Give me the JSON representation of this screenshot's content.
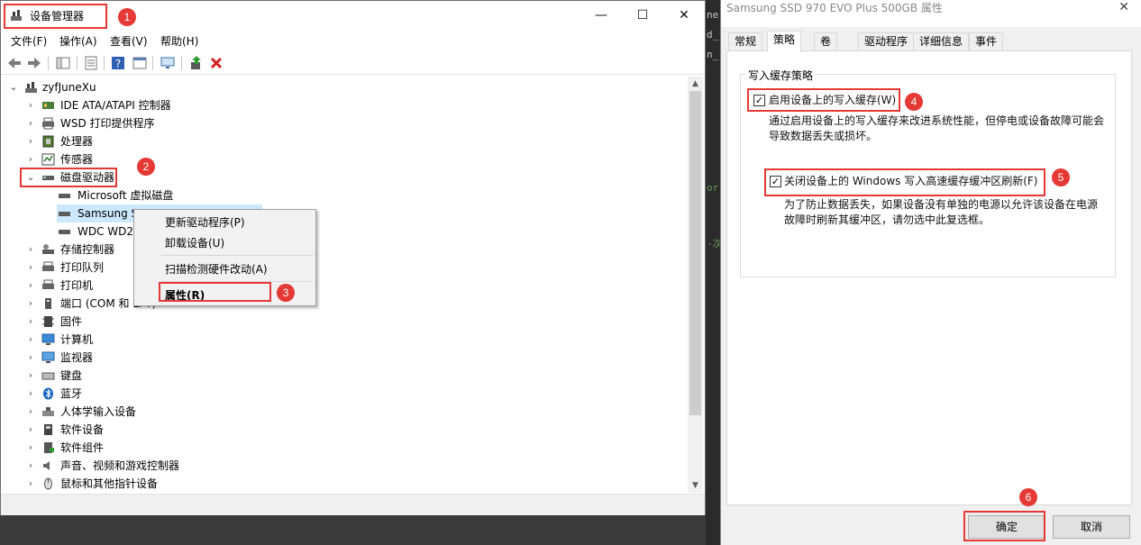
{
  "device_manager": {
    "title": "设备管理器",
    "menus": [
      "文件(F)",
      "操作(A)",
      "查看(V)",
      "帮助(H)"
    ],
    "window_controls": {
      "minimize": "—",
      "maximize": "☐",
      "close": "✕"
    },
    "tree": {
      "root": "zyfJuneXu",
      "categories": [
        {
          "label": "IDE ATA/ATAPI 控制器",
          "icon": "ide-controller-icon"
        },
        {
          "label": "WSD 打印提供程序",
          "icon": "printer-icon"
        },
        {
          "label": "处理器",
          "icon": "processor-icon"
        },
        {
          "label": "传感器",
          "icon": "sensor-icon"
        },
        {
          "label": "磁盘驱动器",
          "icon": "disk-drive-icon",
          "expanded": true,
          "children": [
            "Microsoft 虚拟磁盘",
            "Samsung S",
            "WDC WD2"
          ]
        },
        {
          "label": "存储控制器",
          "icon": "storage-controller-icon"
        },
        {
          "label": "打印队列",
          "icon": "print-queue-icon"
        },
        {
          "label": "打印机",
          "icon": "printer-icon"
        },
        {
          "label": "端口 (COM 和 LPT)",
          "icon": "port-icon"
        },
        {
          "label": "固件",
          "icon": "firmware-icon"
        },
        {
          "label": "计算机",
          "icon": "computer-icon"
        },
        {
          "label": "监视器",
          "icon": "monitor-icon"
        },
        {
          "label": "键盘",
          "icon": "keyboard-icon"
        },
        {
          "label": "蓝牙",
          "icon": "bluetooth-icon"
        },
        {
          "label": "人体学输入设备",
          "icon": "hid-icon"
        },
        {
          "label": "软件设备",
          "icon": "software-device-icon"
        },
        {
          "label": "软件组件",
          "icon": "software-component-icon"
        },
        {
          "label": "声音、视频和游戏控制器",
          "icon": "audio-icon"
        },
        {
          "label": "鼠标和其他指针设备",
          "icon": "mouse-icon"
        }
      ]
    },
    "context_menu": {
      "items": [
        "更新驱动程序(P)",
        "卸载设备(U)",
        "扫描检测硬件改动(A)",
        "属性(R)"
      ]
    }
  },
  "properties_dialog": {
    "title": "Samsung SSD 970 EVO Plus 500GB 属性",
    "close": "✕",
    "tabs": [
      "常规",
      "策略",
      "卷",
      "驱动程序",
      "详细信息",
      "事件"
    ],
    "active_tab": "策略",
    "group_title": "写入缓存策略",
    "enable_write_cache": {
      "label": "启用设备上的写入缓存(W)",
      "checked": true,
      "description_line1": "通过启用设备上的写入缓存来改进系统性能，但停电或设备故障可能会",
      "description_line2": "导致数据丢失或损坏。"
    },
    "disable_flush": {
      "label": "关闭设备上的 Windows 写入高速缓存缓冲区刷新(F)",
      "checked": true,
      "description_line1": "为了防止数据丢失，如果设备没有单独的电源以允许该设备在电源",
      "description_line2": "故障时刷新其缓冲区，请勿选中此复选框。"
    },
    "ok_button": "确定",
    "cancel_button": "取消"
  },
  "annotations": [
    "1",
    "2",
    "3",
    "4",
    "5",
    "6"
  ],
  "colors": {
    "annotation": "#e53935",
    "selection": "#cce8ff"
  }
}
